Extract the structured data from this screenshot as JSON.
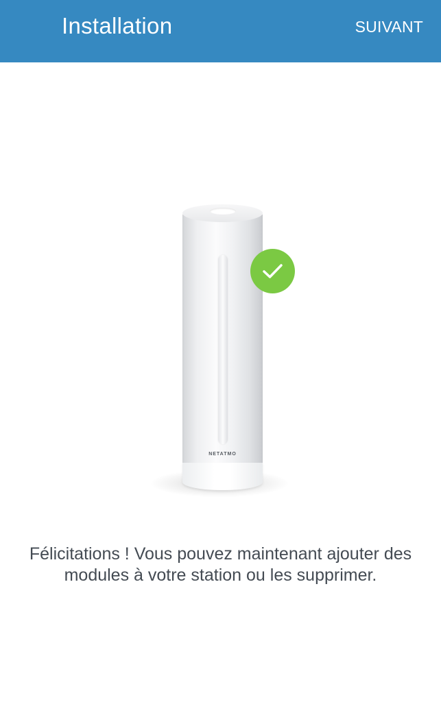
{
  "header": {
    "title": "Installation",
    "next_label": "SUIVANT",
    "background_color": "#3689c1"
  },
  "device": {
    "brand_label": "NETATMO",
    "status_icon": "checkmark-icon",
    "status_color": "#7bc943"
  },
  "message": {
    "text": "Félicitations ! Vous pouvez maintenant ajouter des modules à votre station ou les supprimer."
  }
}
